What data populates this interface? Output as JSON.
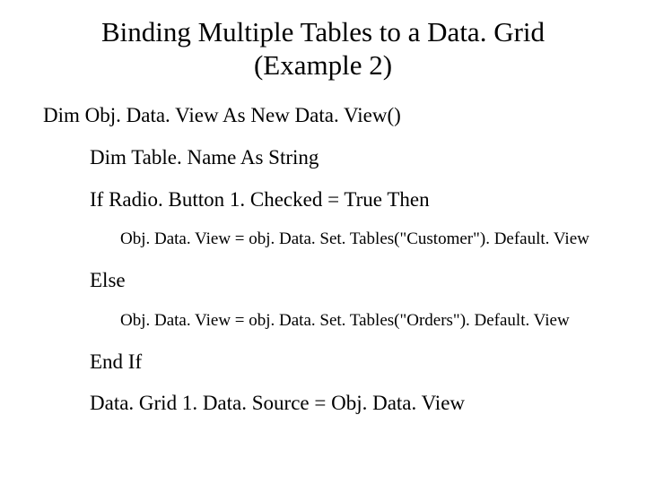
{
  "title_line1": "Binding Multiple Tables to a Data. Grid",
  "title_line2": "(Example 2)",
  "code": {
    "l1": "Dim Obj. Data. View As New Data. View()",
    "l2": "Dim Table. Name As String",
    "l3": "If Radio. Button 1. Checked = True Then",
    "l4": "Obj. Data. View = obj. Data. Set. Tables(\"Customer\"). Default. View",
    "l5": "Else",
    "l6": "Obj. Data. View = obj. Data. Set. Tables(\"Orders\"). Default. View",
    "l7": "End If",
    "l8": "Data. Grid 1. Data. Source = Obj. Data. View"
  }
}
